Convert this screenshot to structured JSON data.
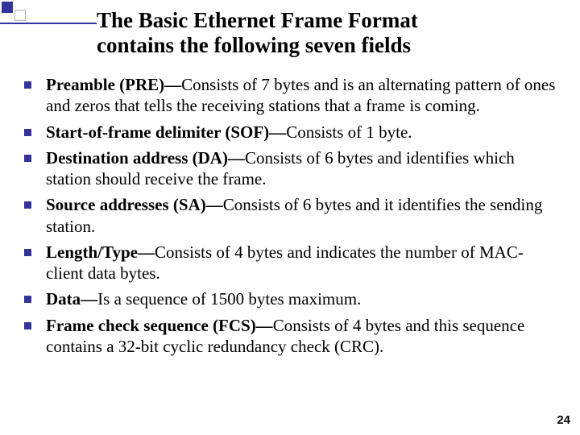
{
  "title": {
    "line1": "The Basic Ethernet Frame Format",
    "line2": "contains the following seven fields"
  },
  "bullets": [
    {
      "bold": "Preamble (PRE)—",
      "rest": "Consists of 7 bytes and is an alternating pattern of ones and zeros that tells the receiving stations that a frame is coming."
    },
    {
      "bold": "Start-of-frame delimiter (SOF)—",
      "rest": "Consists of 1 byte."
    },
    {
      "bold": "Destination address (DA)—",
      "rest": "Consists of 6 bytes and identifies which station should receive the frame."
    },
    {
      "bold": "Source addresses (SA)—",
      "rest": "Consists of 6 bytes and it identifies the sending station."
    },
    {
      "bold": "Length/Type—",
      "rest": "Consists of 4 bytes and indicates  the number of MAC-client data bytes."
    },
    {
      "bold": "Data—",
      "rest": "Is a sequence of 1500 bytes maximum."
    },
    {
      "bold": "Frame check sequence (FCS)—",
      "rest": "Consists of 4 bytes and this sequence contains a 32-bit cyclic redundancy check (CRC)."
    }
  ],
  "page_number": "24"
}
